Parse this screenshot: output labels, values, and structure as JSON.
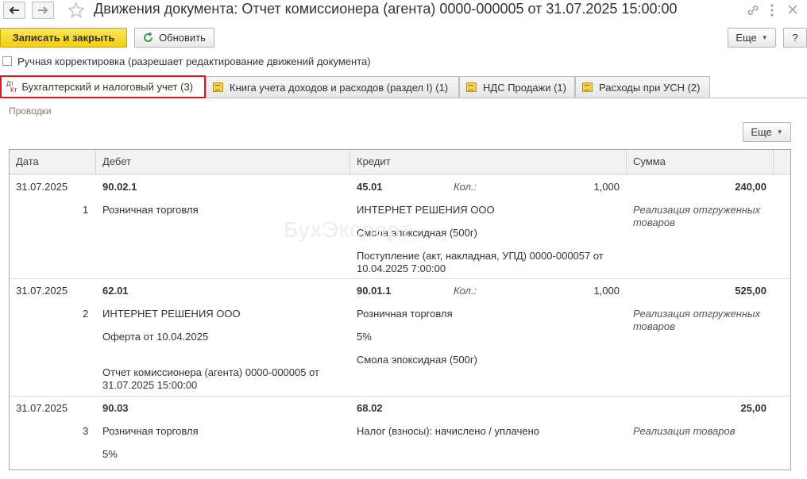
{
  "window": {
    "title": "Движения документа: Отчет комиссионера (агента) 0000-000005 от 31.07.2025 15:00:00",
    "nav_back_icon": "arrow-left-icon",
    "nav_forward_icon": "arrow-right-icon",
    "favorite_icon": "star-icon",
    "link_icon": "link-icon",
    "menu_icon": "more-vertical-icon",
    "close_icon": "close-icon"
  },
  "toolbar": {
    "save_close_label": "Записать и закрыть",
    "refresh_label": "Обновить",
    "more_label": "Еще",
    "help_label": "?"
  },
  "manual_edit": {
    "label": "Ручная корректировка (разрешает редактирование движений документа)",
    "checked": false
  },
  "tabs": [
    {
      "label": "Бухгалтерский и налоговый учет (3)",
      "active": true,
      "icon": "dt-kt-icon"
    },
    {
      "label": "Книга учета доходов и расходов (раздел I) (1)",
      "active": false,
      "icon": "register-icon"
    },
    {
      "label": "НДС Продажи (1)",
      "active": false,
      "icon": "register-icon"
    },
    {
      "label": "Расходы при УСН (2)",
      "active": false,
      "icon": "register-icon"
    }
  ],
  "tab_icon_text": {
    "dt": "Дт",
    "kt": "Кт"
  },
  "section_label": "Проводки",
  "table_more_label": "Еще",
  "watermark": "БухЭксперт",
  "colors": {
    "accent_yellow": "#f5cc12",
    "active_tab_border": "#e1161c",
    "refresh_green": "#2e9b3a"
  },
  "table": {
    "columns": [
      "Дата",
      "Дебет",
      "Кредит",
      "Сумма"
    ],
    "rows": [
      {
        "date": "31.07.2025",
        "num": "1",
        "debit_account": "90.02.1",
        "debit_lines": [
          "Розничная торговля"
        ],
        "credit_account": "45.01",
        "qty_label": "Кол.:",
        "qty": "1,000",
        "credit_lines": [
          "ИНТЕРНЕТ РЕШЕНИЯ ООО",
          "Смола эпоксидная (500г)",
          "Поступление (акт, накладная, УПД) 0000-000057 от",
          "10.04.2025 7:00:00"
        ],
        "amount": "240,00",
        "content": [
          "Реализация отгруженных",
          "товаров"
        ]
      },
      {
        "date": "31.07.2025",
        "num": "2",
        "debit_account": "62.01",
        "debit_lines": [
          "ИНТЕРНЕТ РЕШЕНИЯ ООО",
          "Оферта от 10.04.2025",
          "Отчет комиссионера (агента) 0000-000005 от",
          "31.07.2025 15:00:00"
        ],
        "credit_account": "90.01.1",
        "qty_label": "Кол.:",
        "qty": "1,000",
        "credit_lines": [
          "Розничная торговля",
          "5%",
          "Смола эпоксидная (500г)"
        ],
        "amount": "525,00",
        "content": [
          "Реализация отгруженных",
          "товаров"
        ]
      },
      {
        "date": "31.07.2025",
        "num": "3",
        "debit_account": "90.03",
        "debit_lines": [
          "Розничная торговля",
          "5%"
        ],
        "credit_account": "68.02",
        "credit_lines": [
          "Налог (взносы): начислено / уплачено"
        ],
        "amount": "25,00",
        "content": [
          "Реализация товаров"
        ]
      }
    ]
  }
}
